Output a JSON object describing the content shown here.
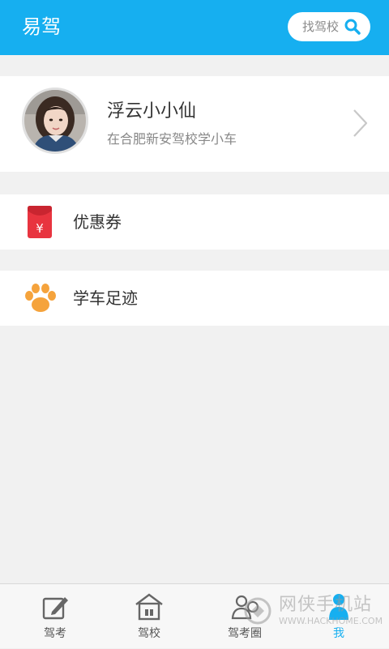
{
  "header": {
    "title": "易驾",
    "search_label": "找驾校"
  },
  "profile": {
    "name": "浮云小小仙",
    "subtitle": "在合肥新安驾校学小车"
  },
  "menu": {
    "items": [
      {
        "label": "优惠券",
        "icon": "red-envelope-icon"
      },
      {
        "label": "学车足迹",
        "icon": "paw-print-icon"
      }
    ]
  },
  "tabs": [
    {
      "label": "驾考",
      "icon": "edit-note-icon"
    },
    {
      "label": "驾校",
      "icon": "school-building-icon"
    },
    {
      "label": "驾考圈",
      "icon": "community-icon"
    },
    {
      "label": "我",
      "icon": "person-icon",
      "active": true
    }
  ],
  "watermark": {
    "text": "网侠手机站",
    "url": "WWW.HACKHOME.COM"
  },
  "colors": {
    "accent": "#16aff0",
    "coupon_red": "#e8343f",
    "paw_orange": "#f5a33c"
  }
}
